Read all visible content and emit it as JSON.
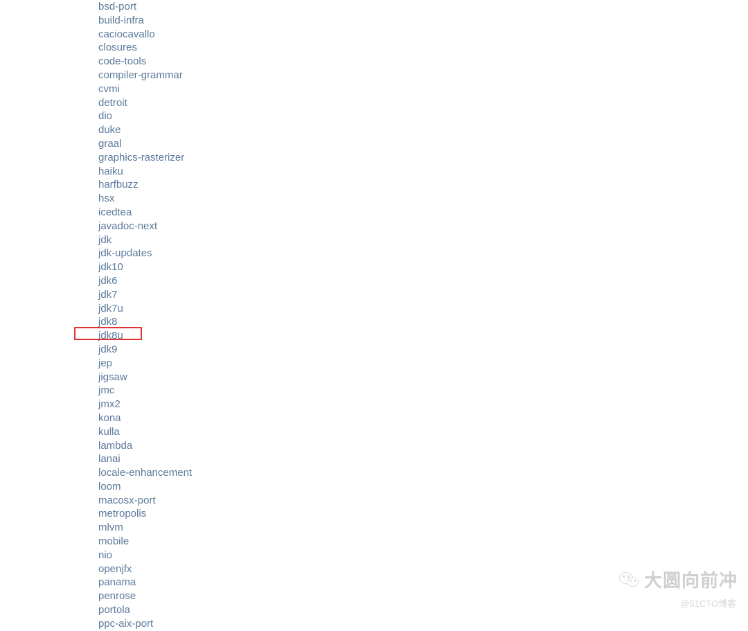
{
  "repos": [
    "bsd-port",
    "build-infra",
    "caciocavallo",
    "closures",
    "code-tools",
    "compiler-grammar",
    "cvmi",
    "detroit",
    "dio",
    "duke",
    "graal",
    "graphics-rasterizer",
    "haiku",
    "harfbuzz",
    "hsx",
    "icedtea",
    "javadoc-next",
    "jdk",
    "jdk-updates",
    "jdk10",
    "jdk6",
    "jdk7",
    "jdk7u",
    "jdk8",
    "jdk8u",
    "jdk9",
    "jep",
    "jigsaw",
    "jmc",
    "jmx2",
    "kona",
    "kulla",
    "lambda",
    "lanai",
    "locale-enhancement",
    "loom",
    "macosx-port",
    "metropolis",
    "mlvm",
    "mobile",
    "nio",
    "openjfx",
    "panama",
    "penrose",
    "portola",
    "ppc-aix-port"
  ],
  "highlighted_index": 24,
  "watermark": {
    "main": "大圆向前冲",
    "sub": "@51CTO博客"
  }
}
